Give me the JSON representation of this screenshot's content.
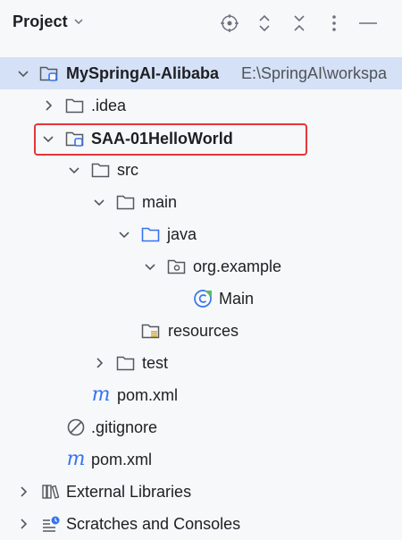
{
  "header": {
    "title": "Project",
    "icons": [
      "locate-icon",
      "expand-collapse-icon",
      "collapse-all-icon",
      "more-vertical-icon",
      "minimize-icon"
    ]
  },
  "tree": {
    "project_root": {
      "name": "MySpringAI-Alibaba",
      "path": "E:\\SpringAI\\workspa"
    },
    "idea": ".idea",
    "module": "SAA-01HelloWorld",
    "src": "src",
    "main": "main",
    "java": "java",
    "package": "org.example",
    "main_class": "Main",
    "resources": "resources",
    "test": "test",
    "module_pom": "pom.xml",
    "gitignore": ".gitignore",
    "root_pom": "pom.xml",
    "external_libraries": "External Libraries",
    "scratches": "Scratches and Consoles"
  },
  "colors": {
    "background": "#f7f8fa",
    "selection": "#d5e1f7",
    "highlight_box": "#e5363c",
    "accent_blue": "#3574f0"
  }
}
